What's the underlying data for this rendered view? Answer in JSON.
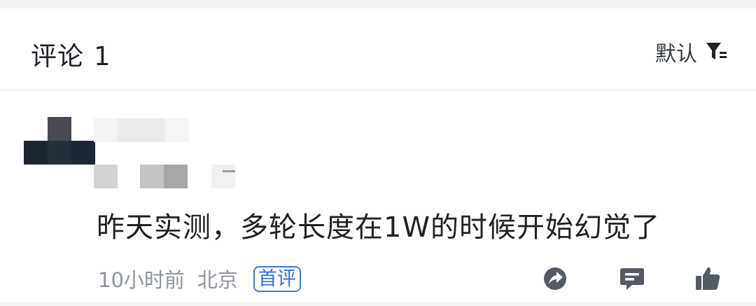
{
  "header": {
    "title": "评论",
    "count": "1",
    "sort_label": "默认",
    "sort_icon": "filter-icon"
  },
  "comment": {
    "avatar_icon": "avatar-pixelated",
    "text": "昨天实测，多轮长度在1W的时候开始幻觉了",
    "time": "10小时前",
    "location": "北京",
    "badge": "首评",
    "actions": [
      {
        "name": "share-icon"
      },
      {
        "name": "reply-icon"
      },
      {
        "name": "like-icon"
      }
    ]
  },
  "colors": {
    "badge_blue": "#2f6fd9",
    "meta_gray": "#8f959e",
    "icon_gray": "#545a63"
  }
}
